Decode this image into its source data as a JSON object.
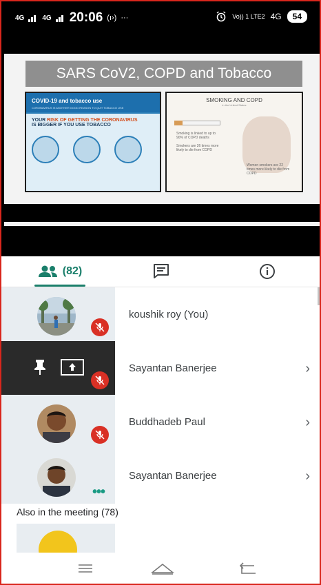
{
  "status_bar": {
    "left_signal_1": "4G",
    "left_signal_2": "4G",
    "time": "20:06",
    "data_indicator": "(ı›)",
    "overflow": "···",
    "volte": "Vo)) 1 LTE2",
    "network": "4G",
    "battery": "54"
  },
  "slide": {
    "title": "SARS CoV2, COPD and Tobacco",
    "left_heading": "COVID-19 and tobacco use",
    "left_sub": "CORONAVIRUS IS ANOTHER GOOD REASON TO QUIT TOBACCO USE",
    "risk_prefix": "YOUR ",
    "risk_highlight": "RISK OF GETTING THE CORONAVIRUS",
    "risk_suffix": "IS BIGGER IF YOU USE TOBACCO",
    "right_heading": "SMOKING AND COPD",
    "right_sub": "in the United States",
    "stat_1": "Smoking is linked to up to 90% of COPD deaths",
    "stat_2": "Smokers are 26 times more likely to die from COPD",
    "stat_3": "Women smokers are 22 times more likely to die from COPD"
  },
  "tabs": {
    "people_count": "(82)",
    "active_color": "#1a7f6b"
  },
  "participants": [
    {
      "name": "koushik roy (You)",
      "muted": true
    },
    {
      "name": "Sayantan Banerjee",
      "muted": true,
      "presenting": true
    },
    {
      "name": "Buddhadeb Paul",
      "muted": true
    },
    {
      "name": "Sayantan Banerjee",
      "muted": false
    }
  ],
  "section": {
    "also_in_meeting": "Also in the meeting (78)"
  },
  "colors": {
    "mute_red": "#d93025",
    "accent_teal": "#1a7f6b",
    "frame_red": "#d9261c"
  }
}
